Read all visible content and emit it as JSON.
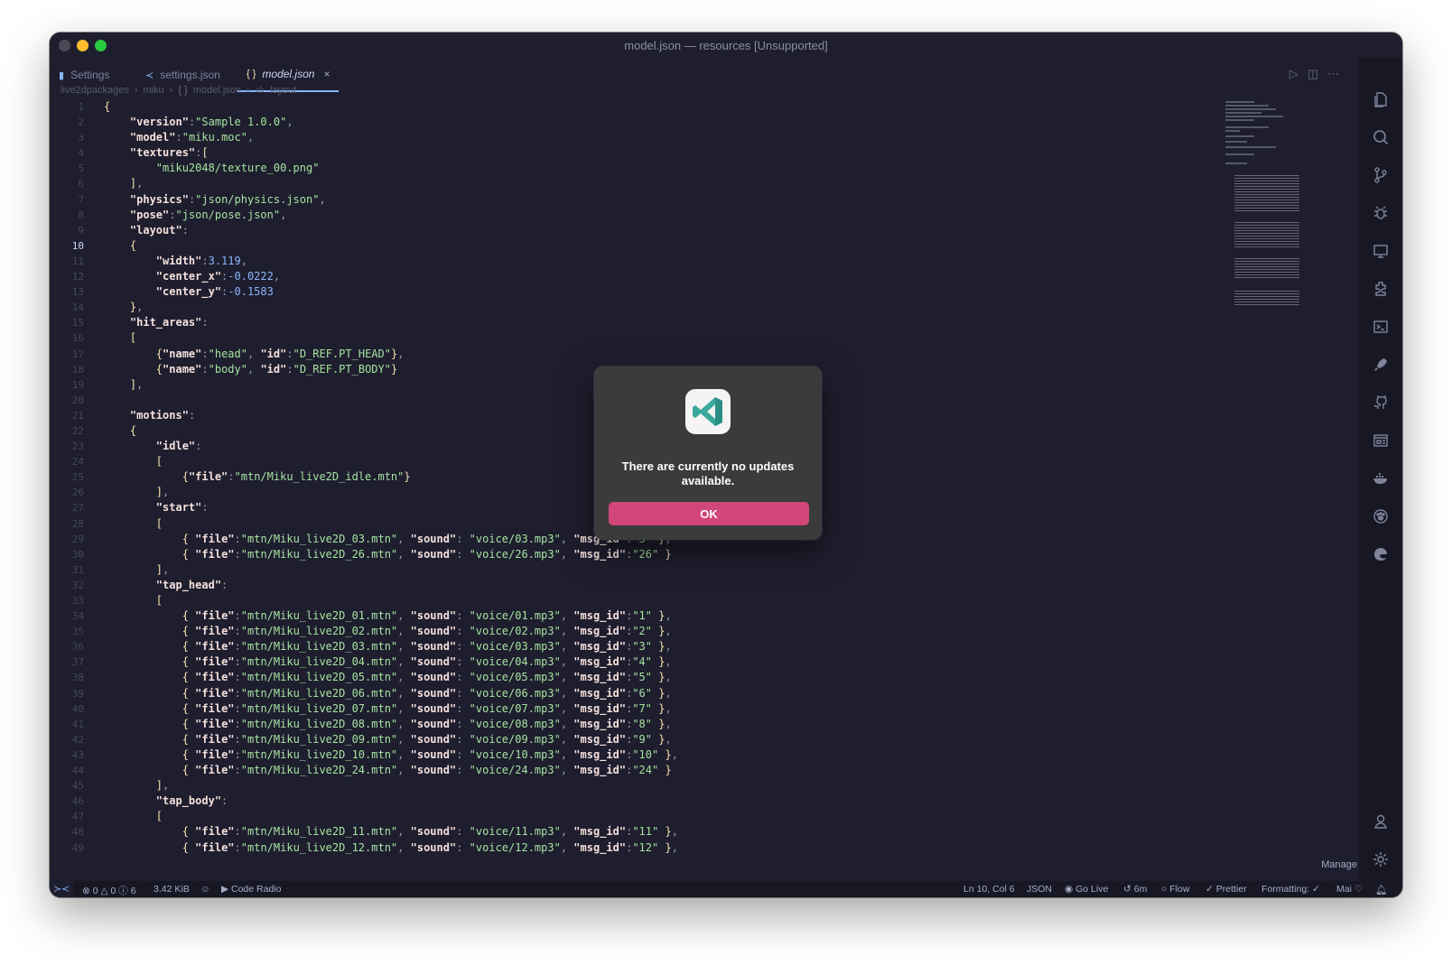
{
  "window": {
    "title": "model.json — resources [Unsupported]"
  },
  "tabs": [
    {
      "label": "Settings",
      "icon": "settings-file-icon"
    },
    {
      "label": "settings.json",
      "icon": "vscode-icon"
    },
    {
      "label": "model.json",
      "icon": "json-braces-icon",
      "close": "×"
    }
  ],
  "breadcrumb": [
    "live2dpackages",
    "miku",
    "model.json",
    "layout"
  ],
  "editor": {
    "current_line": 10
  },
  "dialog": {
    "message": "There are currently no updates available.",
    "ok_label": "OK"
  },
  "activity_bar": {
    "manage_label": "Manage"
  },
  "status_bar": {
    "errors": "0",
    "warnings": "0",
    "info": "6",
    "file_size": "3.42 KiB",
    "code_radio": "Code Radio",
    "cursor": "Ln 10, Col 6",
    "language": "JSON",
    "go_live": "Go Live",
    "time": "6m",
    "flow": "Flow",
    "prettier": "Prettier",
    "formatting": "Formatting: ✓",
    "user": "Mai"
  }
}
